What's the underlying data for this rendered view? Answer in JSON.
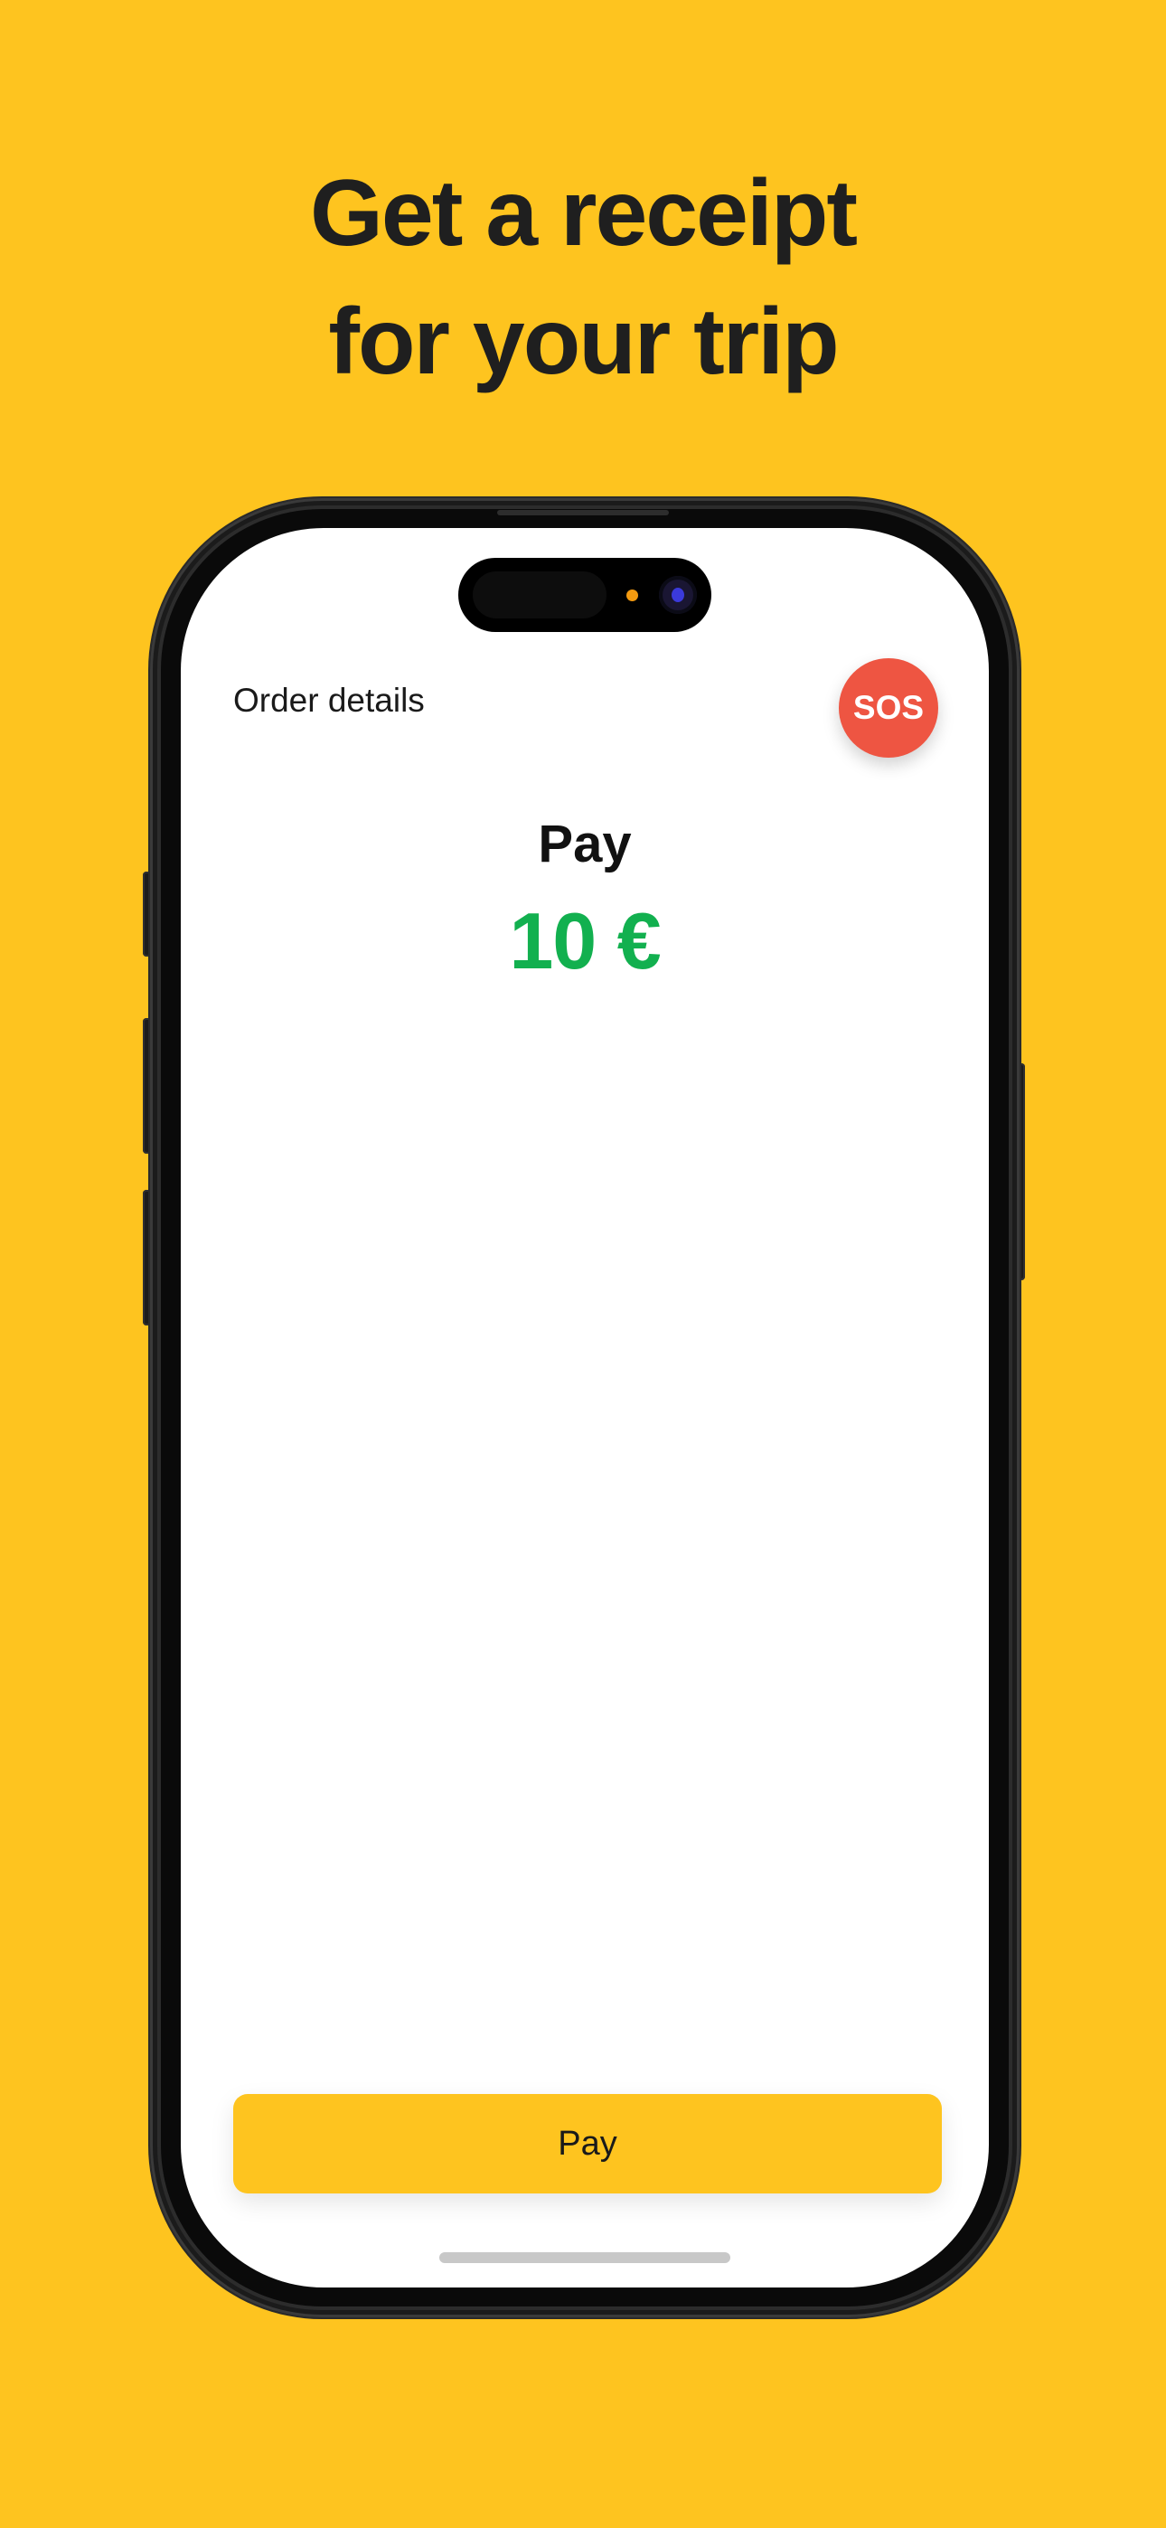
{
  "headline": {
    "line1": "Get a receipt",
    "line2": "for your trip"
  },
  "screen": {
    "header_title": "Order details",
    "sos_label": "SOS",
    "pay_title": "Pay",
    "amount": "10 €",
    "pay_button_label": "Pay"
  },
  "colors": {
    "background": "#FEC41F",
    "sos": "#EE5542",
    "amount": "#12B04F",
    "button": "#FEC41F"
  }
}
